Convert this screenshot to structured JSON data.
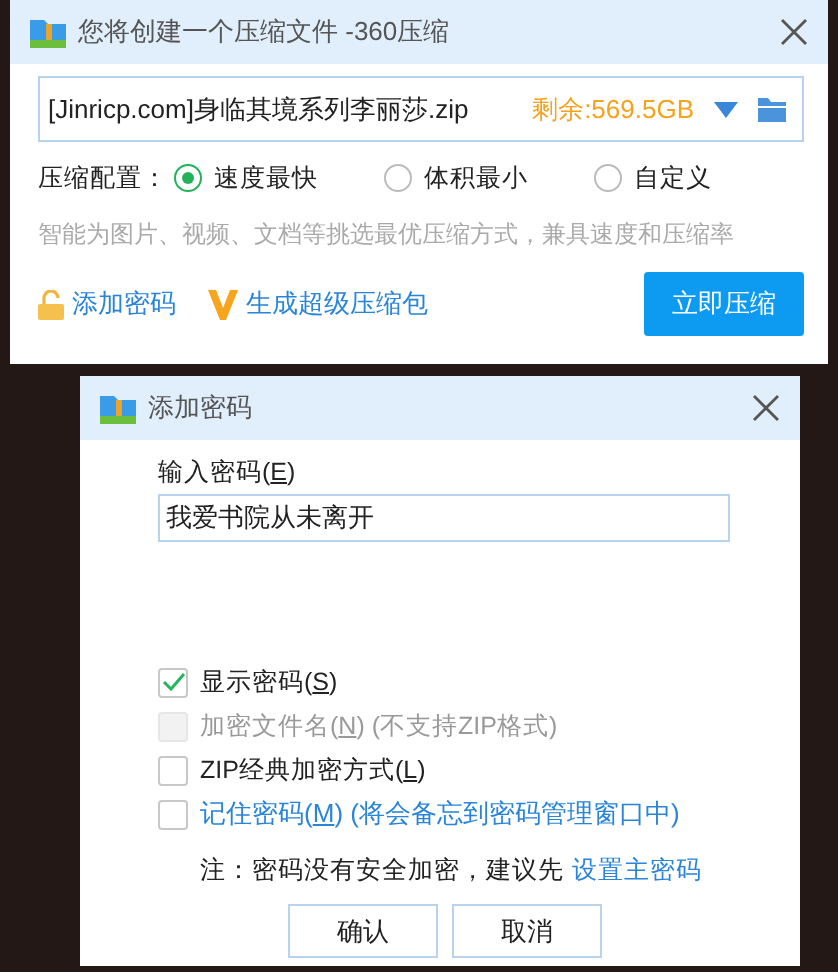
{
  "main_window": {
    "title": "您将创建一个压缩文件 -360压缩",
    "file": {
      "value": "[Jinricp.com]身临其境系列李丽莎.zip",
      "free_space": "剩余:569.5GB"
    },
    "config": {
      "label": "压缩配置：",
      "options": [
        {
          "label": "速度最快",
          "selected": true
        },
        {
          "label": "体积最小",
          "selected": false
        },
        {
          "label": "自定义",
          "selected": false
        }
      ]
    },
    "hint": "智能为图片、视频、文档等挑选最优压缩方式，兼具速度和压缩率",
    "links": [
      {
        "kind": "lock",
        "label": "添加密码"
      },
      {
        "kind": "v",
        "label": "生成超级压缩包"
      }
    ],
    "compress_button": "立即压缩"
  },
  "password_dialog": {
    "title": "添加密码",
    "input_label": {
      "before": "输入密码(",
      "key": "E",
      "after": ")"
    },
    "password": "我爱书院从未离开",
    "options": [
      {
        "kind": "plain",
        "before": "显示密码(",
        "key": "S",
        "after": ")",
        "checked": true,
        "disabled": false
      },
      {
        "kind": "plain",
        "before": "加密文件名(",
        "key": "N",
        "after": ") (不支持ZIP格式)",
        "checked": false,
        "disabled": true
      },
      {
        "kind": "plain",
        "before": "ZIP经典加密方式(",
        "key": "L",
        "after": ")",
        "checked": false,
        "disabled": false
      },
      {
        "kind": "link",
        "before": "记住密码(",
        "key": "M",
        "after": ") (将会备忘到密码管理窗口中)",
        "checked": false,
        "disabled": false
      }
    ],
    "note": "注：密码没有安全加密，建议先",
    "note_link": "设置主密码",
    "buttons": [
      "确认",
      "取消"
    ]
  }
}
